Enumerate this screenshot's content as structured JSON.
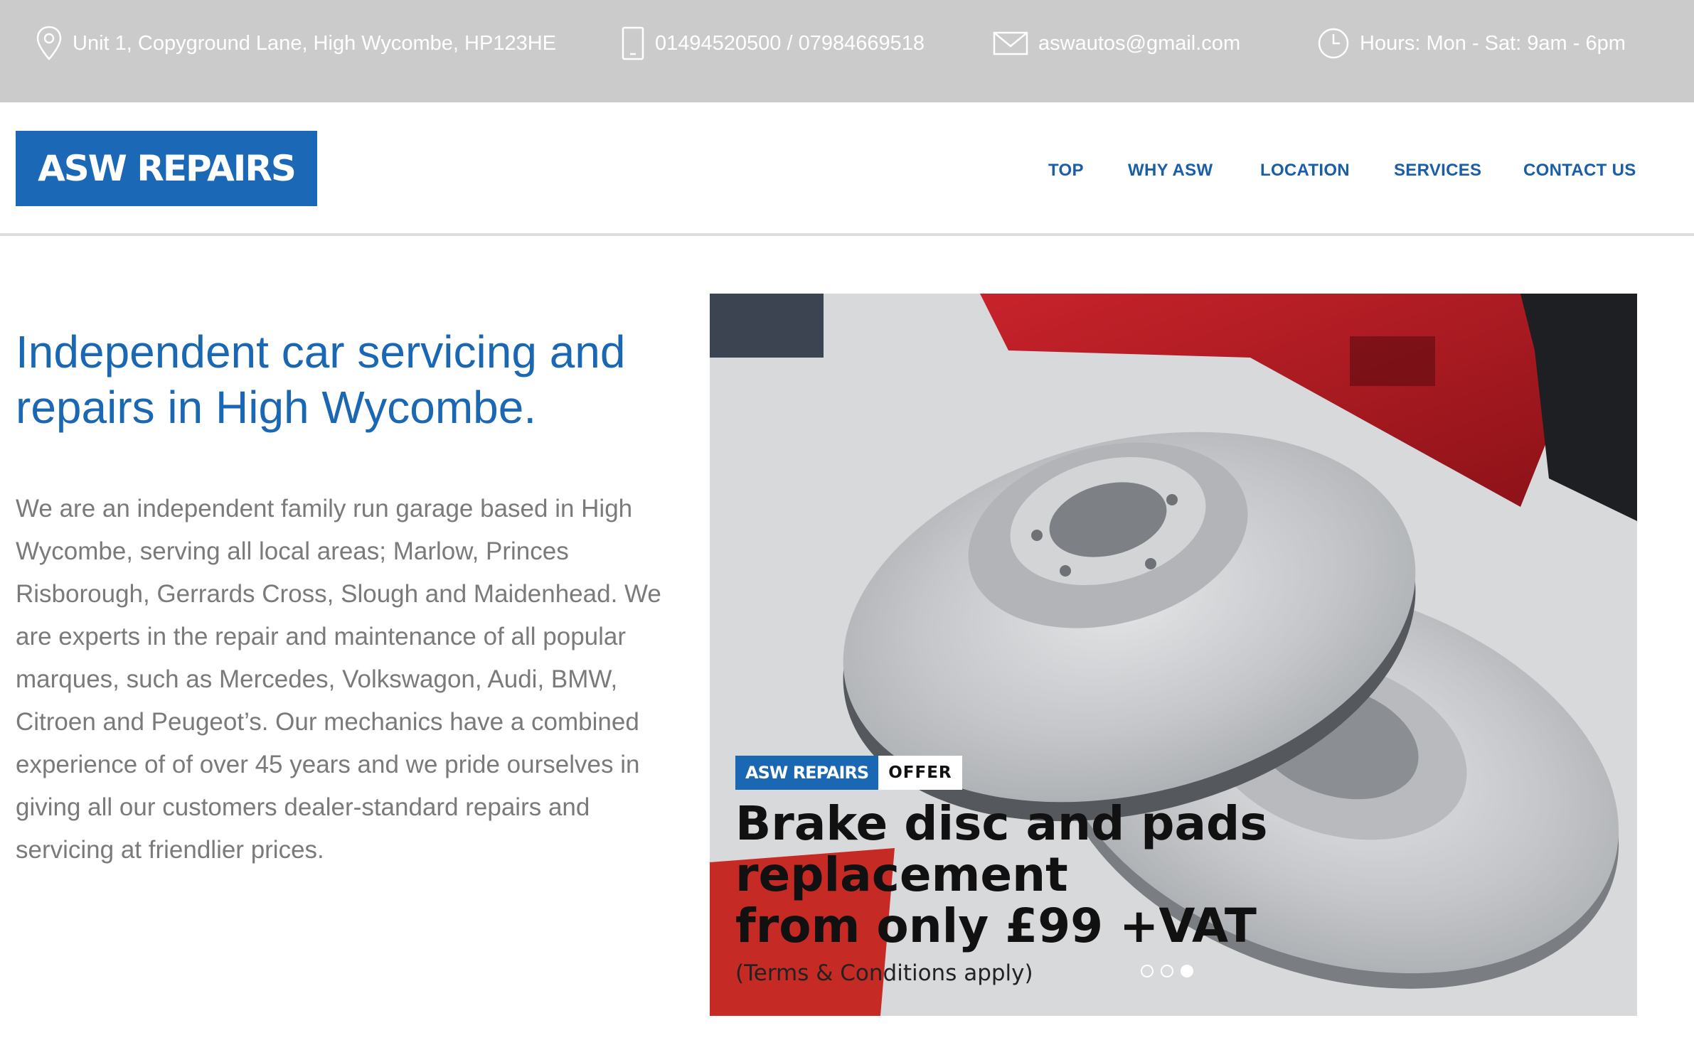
{
  "topbar": {
    "address": "Unit 1, Copyground Lane, High Wycombe, HP123HE",
    "phone": "01494520500 / 07984669518",
    "email": "aswautos@gmail.com",
    "hours": "Hours: Mon - Sat: 9am - 6pm"
  },
  "brand": {
    "logo_text": "ASW REPAIRS"
  },
  "nav": {
    "items": [
      {
        "label": "TOP"
      },
      {
        "label": "WHY ASW"
      },
      {
        "label": "LOCATION"
      },
      {
        "label": "SERVICES"
      },
      {
        "label": "CONTACT US"
      }
    ]
  },
  "hero": {
    "headline": "Independent car servicing and repairs in High Wycombe.",
    "intro": "We are an independent family run garage based in High Wycombe, serving all local areas; Marlow, Princes Risborough, Gerrards Cross, Slough and Maidenhead. We are experts in the repair and maintenance of all popular marques, such as Mercedes, Volkswagon, Audi, BMW, Citroen and Peugeot’s. Our mechanics have a combined experience of of over 45 years and we pride ourselves in giving all our customers dealer-standard repairs and servicing at friendlier prices."
  },
  "slider": {
    "badge_brand": "ASW REPAIRS",
    "badge_offer": "OFFER",
    "title": "Brake disc and pads\nreplacement\nfrom only £99 +VAT",
    "terms": "(Terms & Conditions apply)",
    "slide_count": 3,
    "active_slide": 3
  },
  "colors": {
    "brand_blue": "#1a67b3",
    "topbar_bg": "#cbcbcb",
    "nav_text": "#1a5da8",
    "body_text": "#7a7a7a"
  },
  "icons": {
    "address": "map-pin-icon",
    "phone": "phone-icon",
    "email": "envelope-icon",
    "hours": "clock-icon"
  }
}
